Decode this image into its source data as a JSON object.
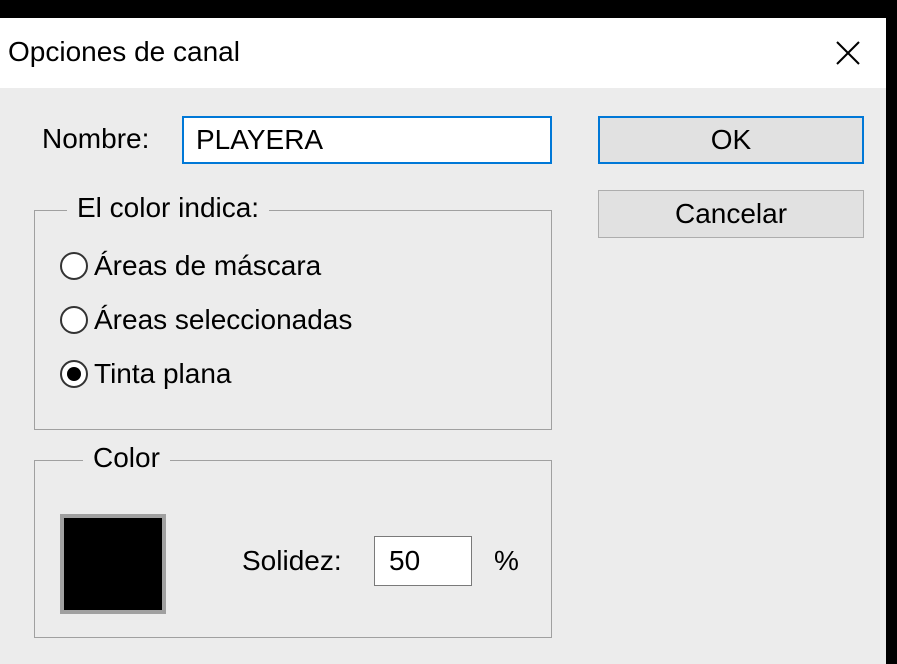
{
  "dialog": {
    "title": "Opciones de canal",
    "close_icon": "close-icon"
  },
  "name_field": {
    "label": "Nombre:",
    "value": "PLAYERA"
  },
  "buttons": {
    "ok_label": "OK",
    "cancel_label": "Cancelar"
  },
  "color_indicates": {
    "legend": "El color indica:",
    "options": [
      {
        "label": "Áreas de máscara",
        "selected": false
      },
      {
        "label": "Áreas seleccionadas",
        "selected": false
      },
      {
        "label": "Tinta plana",
        "selected": true
      }
    ]
  },
  "color_group": {
    "legend": "Color",
    "swatch_color": "#000000",
    "solidity_label": "Solidez:",
    "solidity_value": "50",
    "percent_sign": "%"
  },
  "colors": {
    "accent": "#0078d7",
    "dialog_bg": "#ececec"
  }
}
